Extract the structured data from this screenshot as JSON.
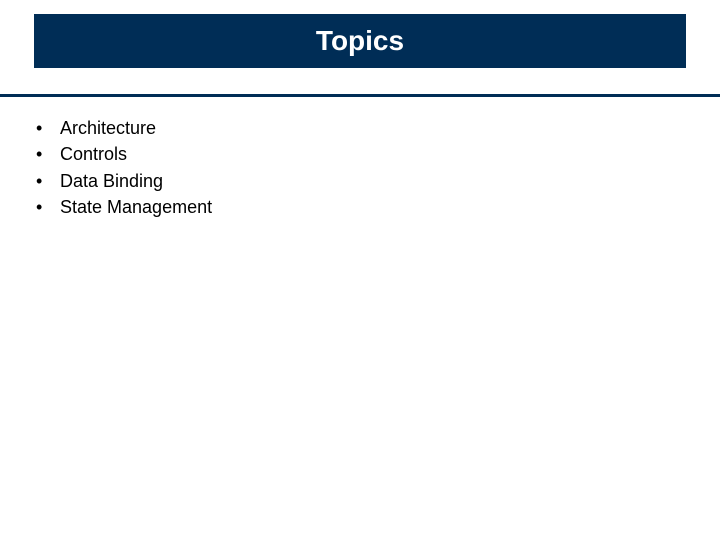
{
  "title": "Topics",
  "bullets": {
    "b0": "Architecture",
    "b1": "Controls",
    "b2": "Data Binding",
    "b3": "State Management"
  }
}
